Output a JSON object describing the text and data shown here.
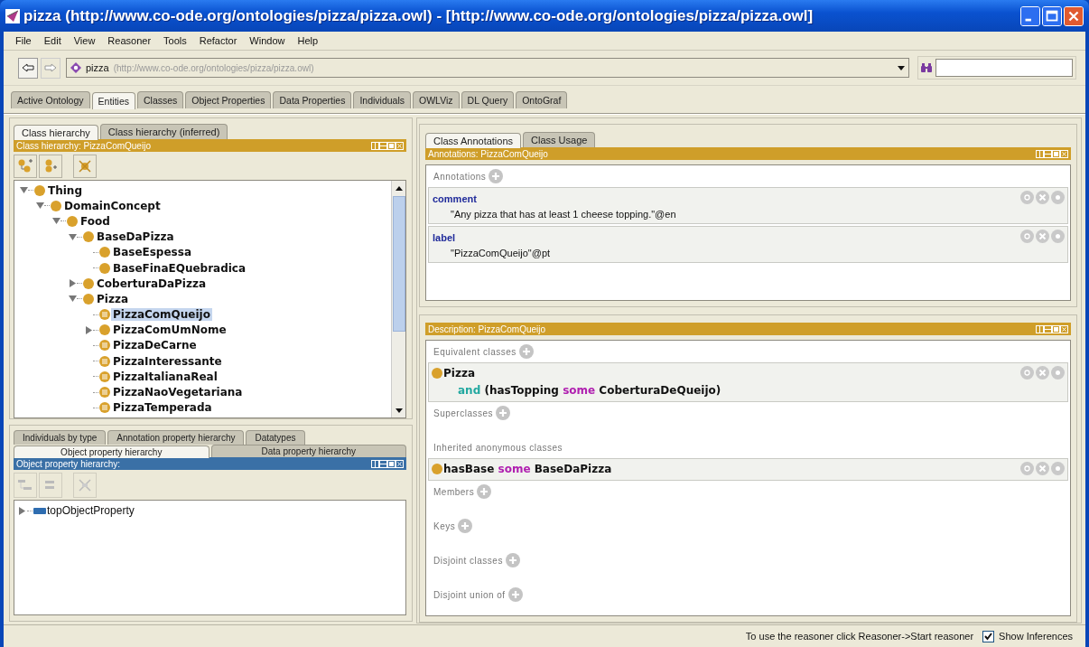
{
  "window": {
    "title": "pizza (http://www.co-ode.org/ontologies/pizza/pizza.owl) - [http://www.co-ode.org/ontologies/pizza/pizza.owl]"
  },
  "menu": [
    "File",
    "Edit",
    "View",
    "Reasoner",
    "Tools",
    "Refactor",
    "Window",
    "Help"
  ],
  "navigation": {
    "ontology_name": "pizza",
    "ontology_iri": "(http://www.co-ode.org/ontologies/pizza/pizza.owl)"
  },
  "tabs": [
    {
      "label": "Active Ontology",
      "selected": false
    },
    {
      "label": "Entities",
      "selected": true
    },
    {
      "label": "Classes",
      "selected": false
    },
    {
      "label": "Object Properties",
      "selected": false
    },
    {
      "label": "Data Properties",
      "selected": false
    },
    {
      "label": "Individuals",
      "selected": false
    },
    {
      "label": "OWLViz",
      "selected": false
    },
    {
      "label": "DL Query",
      "selected": false
    },
    {
      "label": "OntoGraf",
      "selected": false
    }
  ],
  "class_hierarchy": {
    "tabs": [
      {
        "label": "Class hierarchy",
        "selected": true
      },
      {
        "label": "Class hierarchy (inferred)",
        "selected": false
      }
    ],
    "header": "Class hierarchy: PizzaComQueijo",
    "tree": [
      {
        "label": "Thing",
        "kind": "primitive",
        "expanded": true,
        "selected": false,
        "children": [
          {
            "label": "DomainConcept",
            "kind": "primitive",
            "expanded": true,
            "selected": false,
            "children": [
              {
                "label": "Food",
                "kind": "primitive",
                "expanded": true,
                "selected": false,
                "children": [
                  {
                    "label": "BaseDaPizza",
                    "kind": "primitive",
                    "expanded": true,
                    "selected": false,
                    "children": [
                      {
                        "label": "BaseEspessa",
                        "kind": "primitive",
                        "selected": false
                      },
                      {
                        "label": "BaseFinaEQuebradica",
                        "kind": "primitive",
                        "selected": false
                      }
                    ]
                  },
                  {
                    "label": "CoberturaDaPizza",
                    "kind": "primitive",
                    "expanded": false,
                    "selected": false
                  },
                  {
                    "label": "Pizza",
                    "kind": "primitive",
                    "expanded": true,
                    "selected": false,
                    "children": [
                      {
                        "label": "PizzaComQueijo",
                        "kind": "defined",
                        "selected": true
                      },
                      {
                        "label": "PizzaComUmNome",
                        "kind": "primitive",
                        "expanded": false,
                        "selected": false
                      },
                      {
                        "label": "PizzaDeCarne",
                        "kind": "defined",
                        "selected": false
                      },
                      {
                        "label": "PizzaInteressante",
                        "kind": "defined",
                        "selected": false
                      },
                      {
                        "label": "PizzaItalianaReal",
                        "kind": "defined",
                        "selected": false
                      },
                      {
                        "label": "PizzaNaoVegetariana",
                        "kind": "defined",
                        "selected": false
                      },
                      {
                        "label": "PizzaTemperada",
                        "kind": "defined",
                        "selected": false
                      }
                    ]
                  }
                ]
              }
            ]
          }
        ]
      }
    ]
  },
  "property_hierarchy": {
    "tabs_back": [
      {
        "label": "Individuals by type",
        "selected": false
      },
      {
        "label": "Annotation property hierarchy",
        "selected": false
      },
      {
        "label": "Datatypes",
        "selected": false
      }
    ],
    "tabs_front": [
      {
        "label": "Object property hierarchy",
        "selected": true
      },
      {
        "label": "Data property hierarchy",
        "selected": false
      }
    ],
    "header": "Object property hierarchy:",
    "tree": [
      {
        "label": "topObjectProperty",
        "expanded": false,
        "selected": false
      }
    ]
  },
  "annotations_view": {
    "tabs": [
      {
        "label": "Class Annotations",
        "selected": true
      },
      {
        "label": "Class Usage",
        "selected": false
      }
    ],
    "header": "Annotations: PizzaComQueijo",
    "section_label": "Annotations",
    "items": [
      {
        "property": "comment",
        "value": "\"Any pizza that has at least 1 cheese topping.\"@en"
      },
      {
        "property": "label",
        "value": "\"PizzaComQueijo\"@pt"
      }
    ]
  },
  "description": {
    "header": "Description: PizzaComQueijo",
    "sections": [
      {
        "label": "Equivalent classes",
        "addable": true,
        "frames": [
          {
            "lines": [
              [
                {
                  "text": "Pizza",
                  "kind": "name"
                }
              ],
              [
                {
                  "text": "and",
                  "kind": "and"
                },
                {
                  "text": "(hasTopping",
                  "kind": "name"
                },
                {
                  "text": "some",
                  "kind": "some"
                },
                {
                  "text": "CoberturaDeQueijo)",
                  "kind": "name"
                }
              ]
            ]
          }
        ]
      },
      {
        "label": "Superclasses",
        "addable": true
      },
      {
        "label": "Inherited anonymous classes",
        "addable": false,
        "frames": [
          {
            "lines": [
              [
                {
                  "text": "hasBase",
                  "kind": "name"
                },
                {
                  "text": "some",
                  "kind": "some"
                },
                {
                  "text": "BaseDaPizza",
                  "kind": "name"
                }
              ]
            ]
          }
        ]
      },
      {
        "label": "Members",
        "addable": true
      },
      {
        "label": "Keys",
        "addable": true
      },
      {
        "label": "Disjoint classes",
        "addable": true
      },
      {
        "label": "Disjoint union of",
        "addable": true
      }
    ]
  },
  "status_bar": {
    "message": "To use the reasoner click Reasoner->Start reasoner",
    "show_inferences": {
      "label": "Show Inferences",
      "checked": true
    }
  }
}
